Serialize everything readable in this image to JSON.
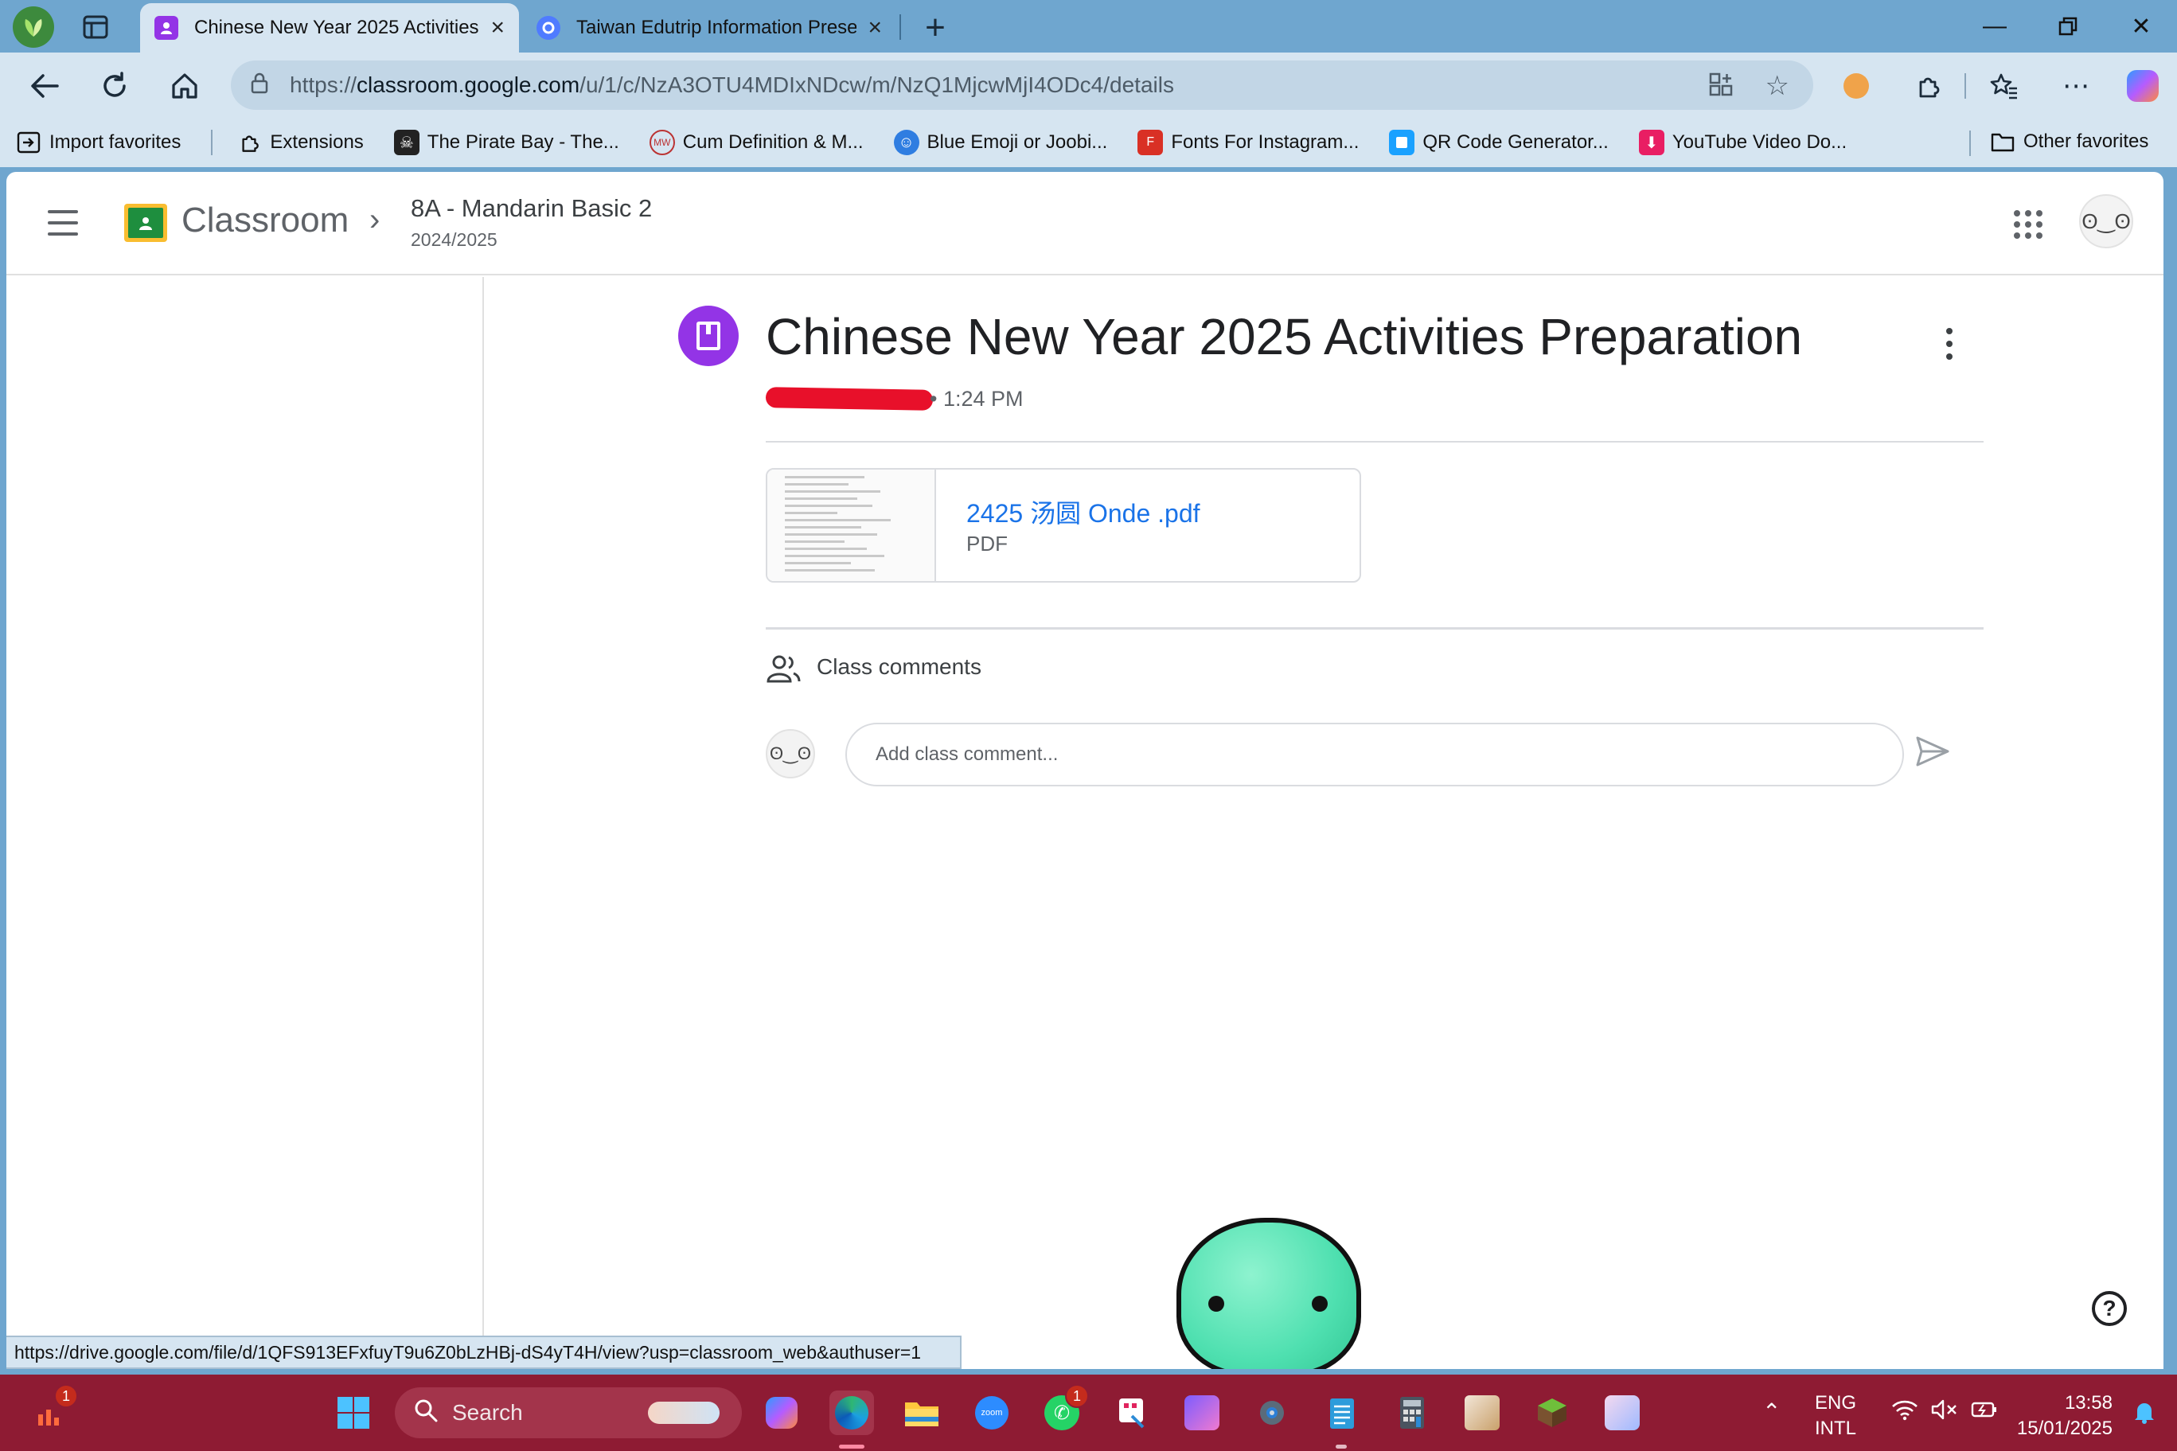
{
  "browser": {
    "tabs": [
      {
        "title": "Chinese New Year 2025 Activities",
        "active": true
      },
      {
        "title": "Taiwan Edutrip Information Presen",
        "active": false
      }
    ],
    "address": {
      "scheme": "https://",
      "host": "classroom.google.com",
      "path": "/u/1/c/NzA3OTU4MDIxNDcw/m/NzQ1MjcwMjI4ODc4/details"
    },
    "bookmarks": [
      {
        "label": "Import favorites",
        "icon": "import-icon"
      },
      {
        "label": "Extensions",
        "icon": "puzzle-icon"
      },
      {
        "label": "The Pirate Bay - The...",
        "icon": "pirate-icon"
      },
      {
        "label": "Cum Definition & M...",
        "icon": "mw-icon"
      },
      {
        "label": "Blue Emoji or Joobi...",
        "icon": "emoji-icon"
      },
      {
        "label": "Fonts For Instagram...",
        "icon": "fonts-icon"
      },
      {
        "label": "QR Code Generator...",
        "icon": "qr-icon"
      },
      {
        "label": "YouTube Video Do...",
        "icon": "download-icon"
      }
    ],
    "other_favorites": "Other favorites"
  },
  "header": {
    "app_name": "Classroom",
    "class_name": "8A - Mandarin Basic 2",
    "class_year": "2024/2025"
  },
  "post": {
    "title": "Chinese New Year 2025 Activities Preparation",
    "time": "• 1:24 PM",
    "attachment": {
      "name": "2425 汤圆 Onde .pdf",
      "type": "PDF"
    }
  },
  "comments": {
    "label": "Class comments",
    "placeholder": "Add class comment..."
  },
  "status_link": "https://drive.google.com/file/d/1QFS913EFxfuyT9u6Z0bLzHBj-dS4yT4H/view?usp=classroom_web&authuser=1",
  "taskbar": {
    "search_label": "Search",
    "lang_top": "ENG",
    "lang_bottom": "INTL",
    "time": "13:58",
    "date": "15/01/2025",
    "badge_count": "1"
  },
  "colors": {
    "accent_purple": "#9334e6",
    "link_blue": "#1a73e8",
    "taskbar": "#8e1b33",
    "chrome": "#6fa6cf"
  }
}
